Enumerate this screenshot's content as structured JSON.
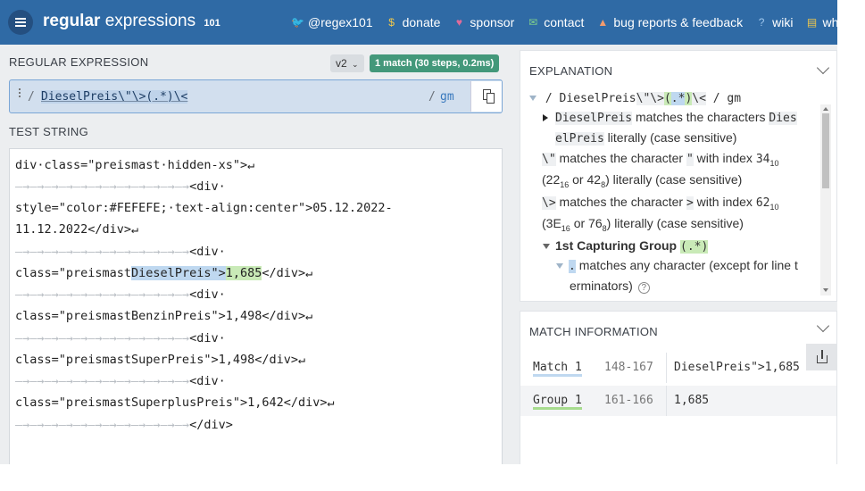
{
  "header": {
    "logo_main": "regular",
    "logo_rest": "expressions",
    "logo_num": "101",
    "nav": [
      {
        "icon": "twitter-icon",
        "glyph": "🐦",
        "label": "@regex101",
        "color": "#9fc7ee"
      },
      {
        "icon": "dollar-icon",
        "glyph": "$",
        "label": "donate",
        "color": "#f1c84b"
      },
      {
        "icon": "heart-icon",
        "glyph": "♥",
        "label": "sponsor",
        "color": "#e06b9a"
      },
      {
        "icon": "mail-icon",
        "glyph": "✉",
        "label": "contact",
        "color": "#7fd08c"
      },
      {
        "icon": "warning-icon",
        "glyph": "▲",
        "label": "bug reports & feedback",
        "color": "#f39b6d"
      },
      {
        "icon": "wiki-icon",
        "glyph": "?",
        "label": "wiki",
        "color": "#9fc7ee"
      },
      {
        "icon": "book-icon",
        "glyph": "▤",
        "label": "what's new",
        "color": "#f1c84b"
      }
    ]
  },
  "regex": {
    "section_title": "REGULAR EXPRESSION",
    "version": "v2",
    "match_badge": "1 match (30 steps, 0.2ms)",
    "delimiter_open": "/",
    "pattern": "DieselPreis\\\"\\>(.*)\\<",
    "delimiter_close": "/",
    "flags": "gm"
  },
  "test": {
    "section_title": "TEST STRING",
    "lines": [
      {
        "pre": "div·class=\"preismast·hidden-xs\">↵"
      },
      {
        "ws": "—→—→—→—→—→—→—→—→—→—→—→—→",
        "pre": "<div·"
      },
      {
        "pre": "style=\"color:#FEFEFE;·text-align:center\">05.12.2022-"
      },
      {
        "pre": "11.12.2022</div>↵"
      },
      {
        "ws": "—→—→—→—→—→—→—→—→—→—→—→—→",
        "pre": "<div·"
      },
      {
        "pre": "class=\"preismast",
        "match": "DieselPreis\">",
        "group": "1,685",
        "post": "</div>↵"
      },
      {
        "ws": "—→—→—→—→—→—→—→—→—→—→—→—→",
        "pre": "<div·"
      },
      {
        "pre": "class=\"preismastBenzinPreis\">1,498</div>↵"
      },
      {
        "ws": "—→—→—→—→—→—→—→—→—→—→—→—→",
        "pre": "<div·"
      },
      {
        "pre": "class=\"preismastSuperPreis\">1,498</div>↵"
      },
      {
        "ws": "—→—→—→—→—→—→—→—→—→—→—→—→",
        "pre": "<div·"
      },
      {
        "pre": "class=\"preismastSuperplusPreis\">1,642</div>↵"
      },
      {
        "ws": "—→—→—→—→—→—→—→—→—→—→—→—→",
        "pre": "</div>"
      }
    ]
  },
  "explanation": {
    "title": "EXPLANATION",
    "root_expr_a": "/ DieselPreis",
    "root_expr_b": "\\\"\\>",
    "root_expr_c": "(",
    "root_expr_d": ".*",
    "root_expr_e": ")",
    "root_expr_f": "\\<",
    "root_expr_g": " / gm",
    "l1_code": "DieselPreis",
    "l1_text": " matches the characters ",
    "l1_code2": "Dies",
    "l2_code": "elPreis",
    "l2_text": " literally (case sensitive)",
    "l3_code": "\\\"",
    "l3_text": " matches the character ",
    "l3_char": "\"",
    "l3_text2": " with index ",
    "l3_idx": "34",
    "l3_sub": "10",
    "l4_a": "(22",
    "l4_sub1": "16",
    "l4_b": " or 42",
    "l4_sub2": "8",
    "l4_c": ") literally (case sensitive)",
    "l5_code": "\\>",
    "l5_text": " matches the character ",
    "l5_char": ">",
    "l5_text2": " with index ",
    "l5_idx": "62",
    "l5_sub": "10",
    "l6_a": "(3E",
    "l6_sub1": "16",
    "l6_b": " or 76",
    "l6_sub2": "8",
    "l6_c": ") literally (case sensitive)",
    "group_label": "1st Capturing Group",
    "group_code": "(.*)",
    "dot_code": ".",
    "dot_text": " matches any character (except for line t",
    "dot_text2": "erminators)",
    "help": "?"
  },
  "match_info": {
    "title": "MATCH INFORMATION",
    "rows": [
      {
        "label": "Match 1",
        "range": "148-167",
        "value": "DieselPreis\">1,685",
        "underline": "#bfd8f0"
      },
      {
        "label": "Group 1",
        "range": "161-166",
        "value": "1,685",
        "underline": "#a7dc8e"
      }
    ]
  }
}
